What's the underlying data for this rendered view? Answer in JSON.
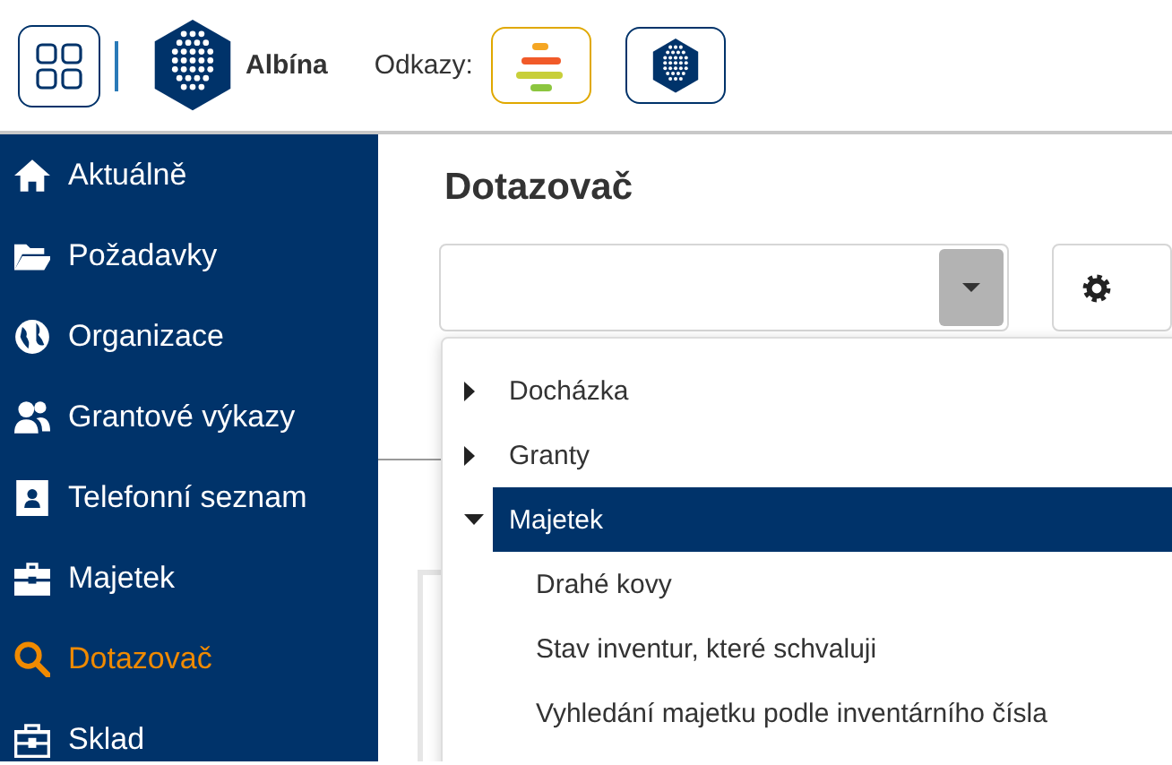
{
  "header": {
    "brand": "Albína",
    "links_label": "Odkazy:"
  },
  "sidebar": {
    "items": [
      {
        "kind": "home",
        "label": "Aktuálně",
        "selected": false
      },
      {
        "kind": "folder",
        "label": "Požadavky",
        "selected": false
      },
      {
        "kind": "globe",
        "label": "Organizace",
        "selected": false
      },
      {
        "kind": "users",
        "label": "Grantové výkazy",
        "selected": false
      },
      {
        "kind": "badge",
        "label": "Telefonní seznam",
        "selected": false
      },
      {
        "kind": "briefcase",
        "label": "Majetek",
        "selected": false
      },
      {
        "kind": "search",
        "label": "Dotazovač",
        "selected": true
      },
      {
        "kind": "toolbox",
        "label": "Sklad",
        "selected": false
      }
    ]
  },
  "page": {
    "title": "Dotazovač"
  },
  "query_select": {
    "expanded": true,
    "tree": [
      {
        "label": "Docházka",
        "expanded": false,
        "selected": false
      },
      {
        "label": "Granty",
        "expanded": false,
        "selected": false
      },
      {
        "label": "Majetek",
        "expanded": true,
        "selected": true,
        "children": [
          {
            "label": "Drahé kovy",
            "selected": false
          },
          {
            "label": "Stav inventur, které schvaluji",
            "selected": false
          },
          {
            "label": "Vyhledání majetku podle inventárního čísla",
            "selected": false
          }
        ]
      }
    ]
  }
}
